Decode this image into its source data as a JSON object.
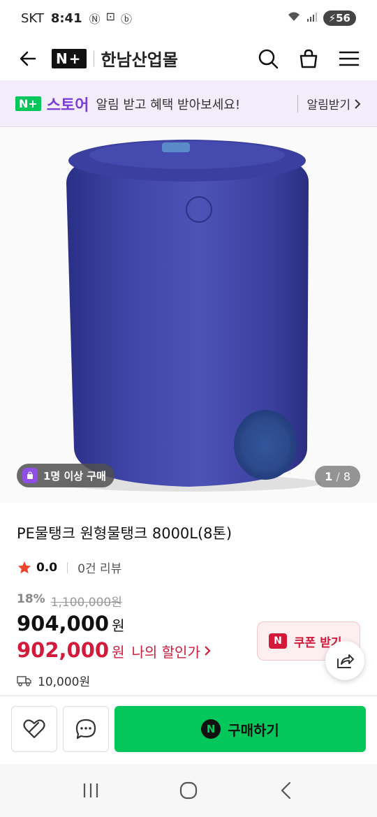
{
  "status_bar": {
    "carrier": "SKT",
    "time": "8:41",
    "battery": "56"
  },
  "header": {
    "np_logo": "N+",
    "store_name": "한남산업몰"
  },
  "banner": {
    "np_logo": "N+",
    "store_label": "스토어",
    "message": "알림 받고 혜택 받아보세요!",
    "cta": "알림받기"
  },
  "product_image": {
    "buyers_badge": "1명 이상 구매",
    "page_current": "1",
    "page_sep": "/",
    "page_total": "8"
  },
  "product": {
    "title": "PE물탱크 원형물탱크 8000L(8톤)",
    "rating": "0.0",
    "review_count": "0건 리뷰",
    "discount_rate": "18%",
    "original_price": "1,100,000원",
    "price": "904,000",
    "price_unit": "원",
    "my_price": "902,000",
    "my_price_unit": "원",
    "my_price_label": "나의 할인가",
    "coupon_label": "쿠폰 받기",
    "coupon_n": "N",
    "delivery_fee": "10,000원"
  },
  "actions": {
    "buy_label": "구매하기",
    "buy_n": "N"
  },
  "colors": {
    "naver_green": "#03c75a",
    "discount_red": "#d31a3a",
    "banner_purple": "#7a3bd6"
  },
  "icons": [
    "back-arrow-icon",
    "search-icon",
    "shopping-bag-icon",
    "menu-icon",
    "chevron-right-icon",
    "star-icon",
    "truck-icon",
    "heart-icon",
    "chat-icon",
    "share-icon",
    "recent-apps-icon",
    "home-icon",
    "back-icon"
  ]
}
